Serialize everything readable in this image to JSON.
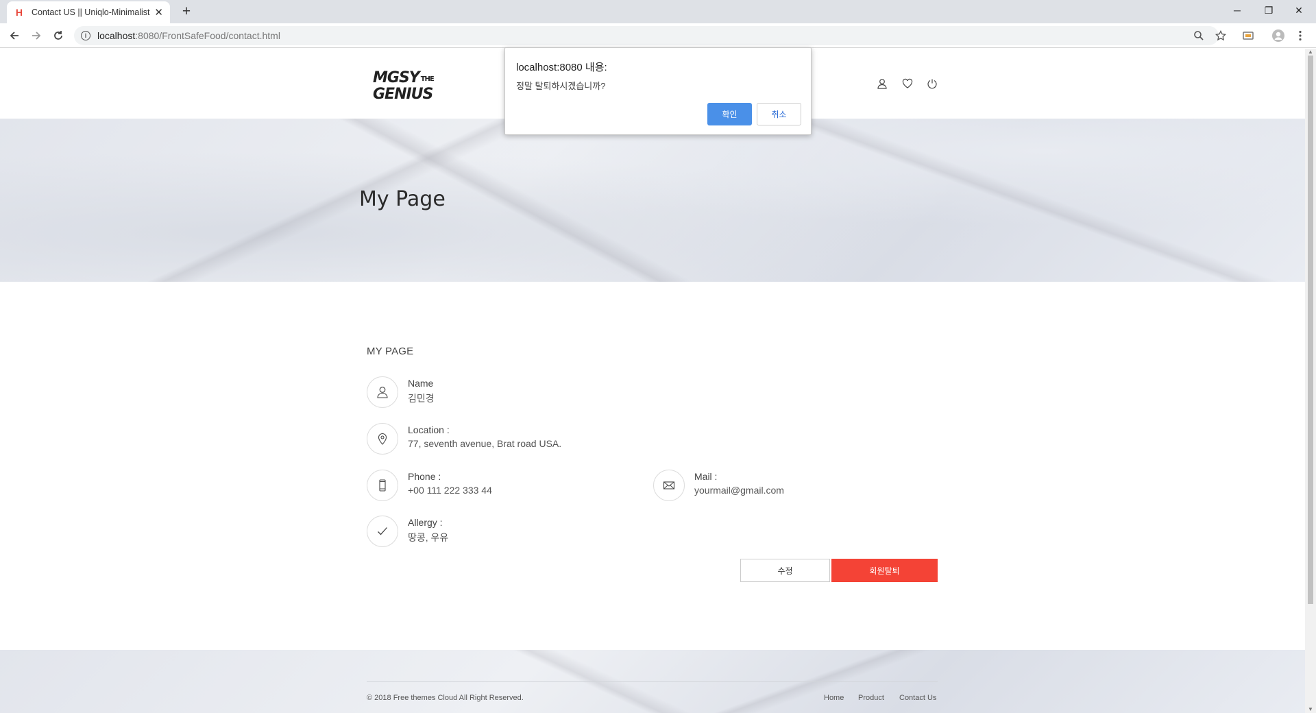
{
  "browser": {
    "tab_title": "Contact US || Uniqlo-Minimalist",
    "tab_favicon": "H",
    "url_host": "localhost",
    "url_path": ":8080/FrontSafeFood/contact.html"
  },
  "header": {
    "logo_line1": "MGSY",
    "logo_the": "THE",
    "logo_line2": "GENIUS",
    "icons": [
      "user-icon",
      "heart-icon",
      "power-icon"
    ]
  },
  "hero": {
    "title": "My Page"
  },
  "mypage": {
    "section_title": "MY PAGE",
    "name_label": "Name",
    "name_value": "김민경",
    "location_label": "Location :",
    "location_value": "77, seventh avenue, Brat road USA.",
    "phone_label": "Phone :",
    "phone_value": "+00 111 222 333 44",
    "mail_label": "Mail :",
    "mail_value": "yourmail@gmail.com",
    "allergy_label": "Allergy :",
    "allergy_value": "땅콩, 우유",
    "edit_button": "수정",
    "withdraw_button": "회원탈퇴"
  },
  "footer": {
    "copyright": "© 2018 Free themes Cloud All Right Reserved.",
    "links": [
      "Home",
      "Product",
      "Contact Us"
    ]
  },
  "dialog": {
    "title": "localhost:8080 내용:",
    "message": "정말 탈퇴하시겠습니까?",
    "ok_label": "확인",
    "cancel_label": "취소"
  },
  "colors": {
    "accent_red": "#f44336",
    "dialog_ok_blue": "#4a90e8"
  }
}
